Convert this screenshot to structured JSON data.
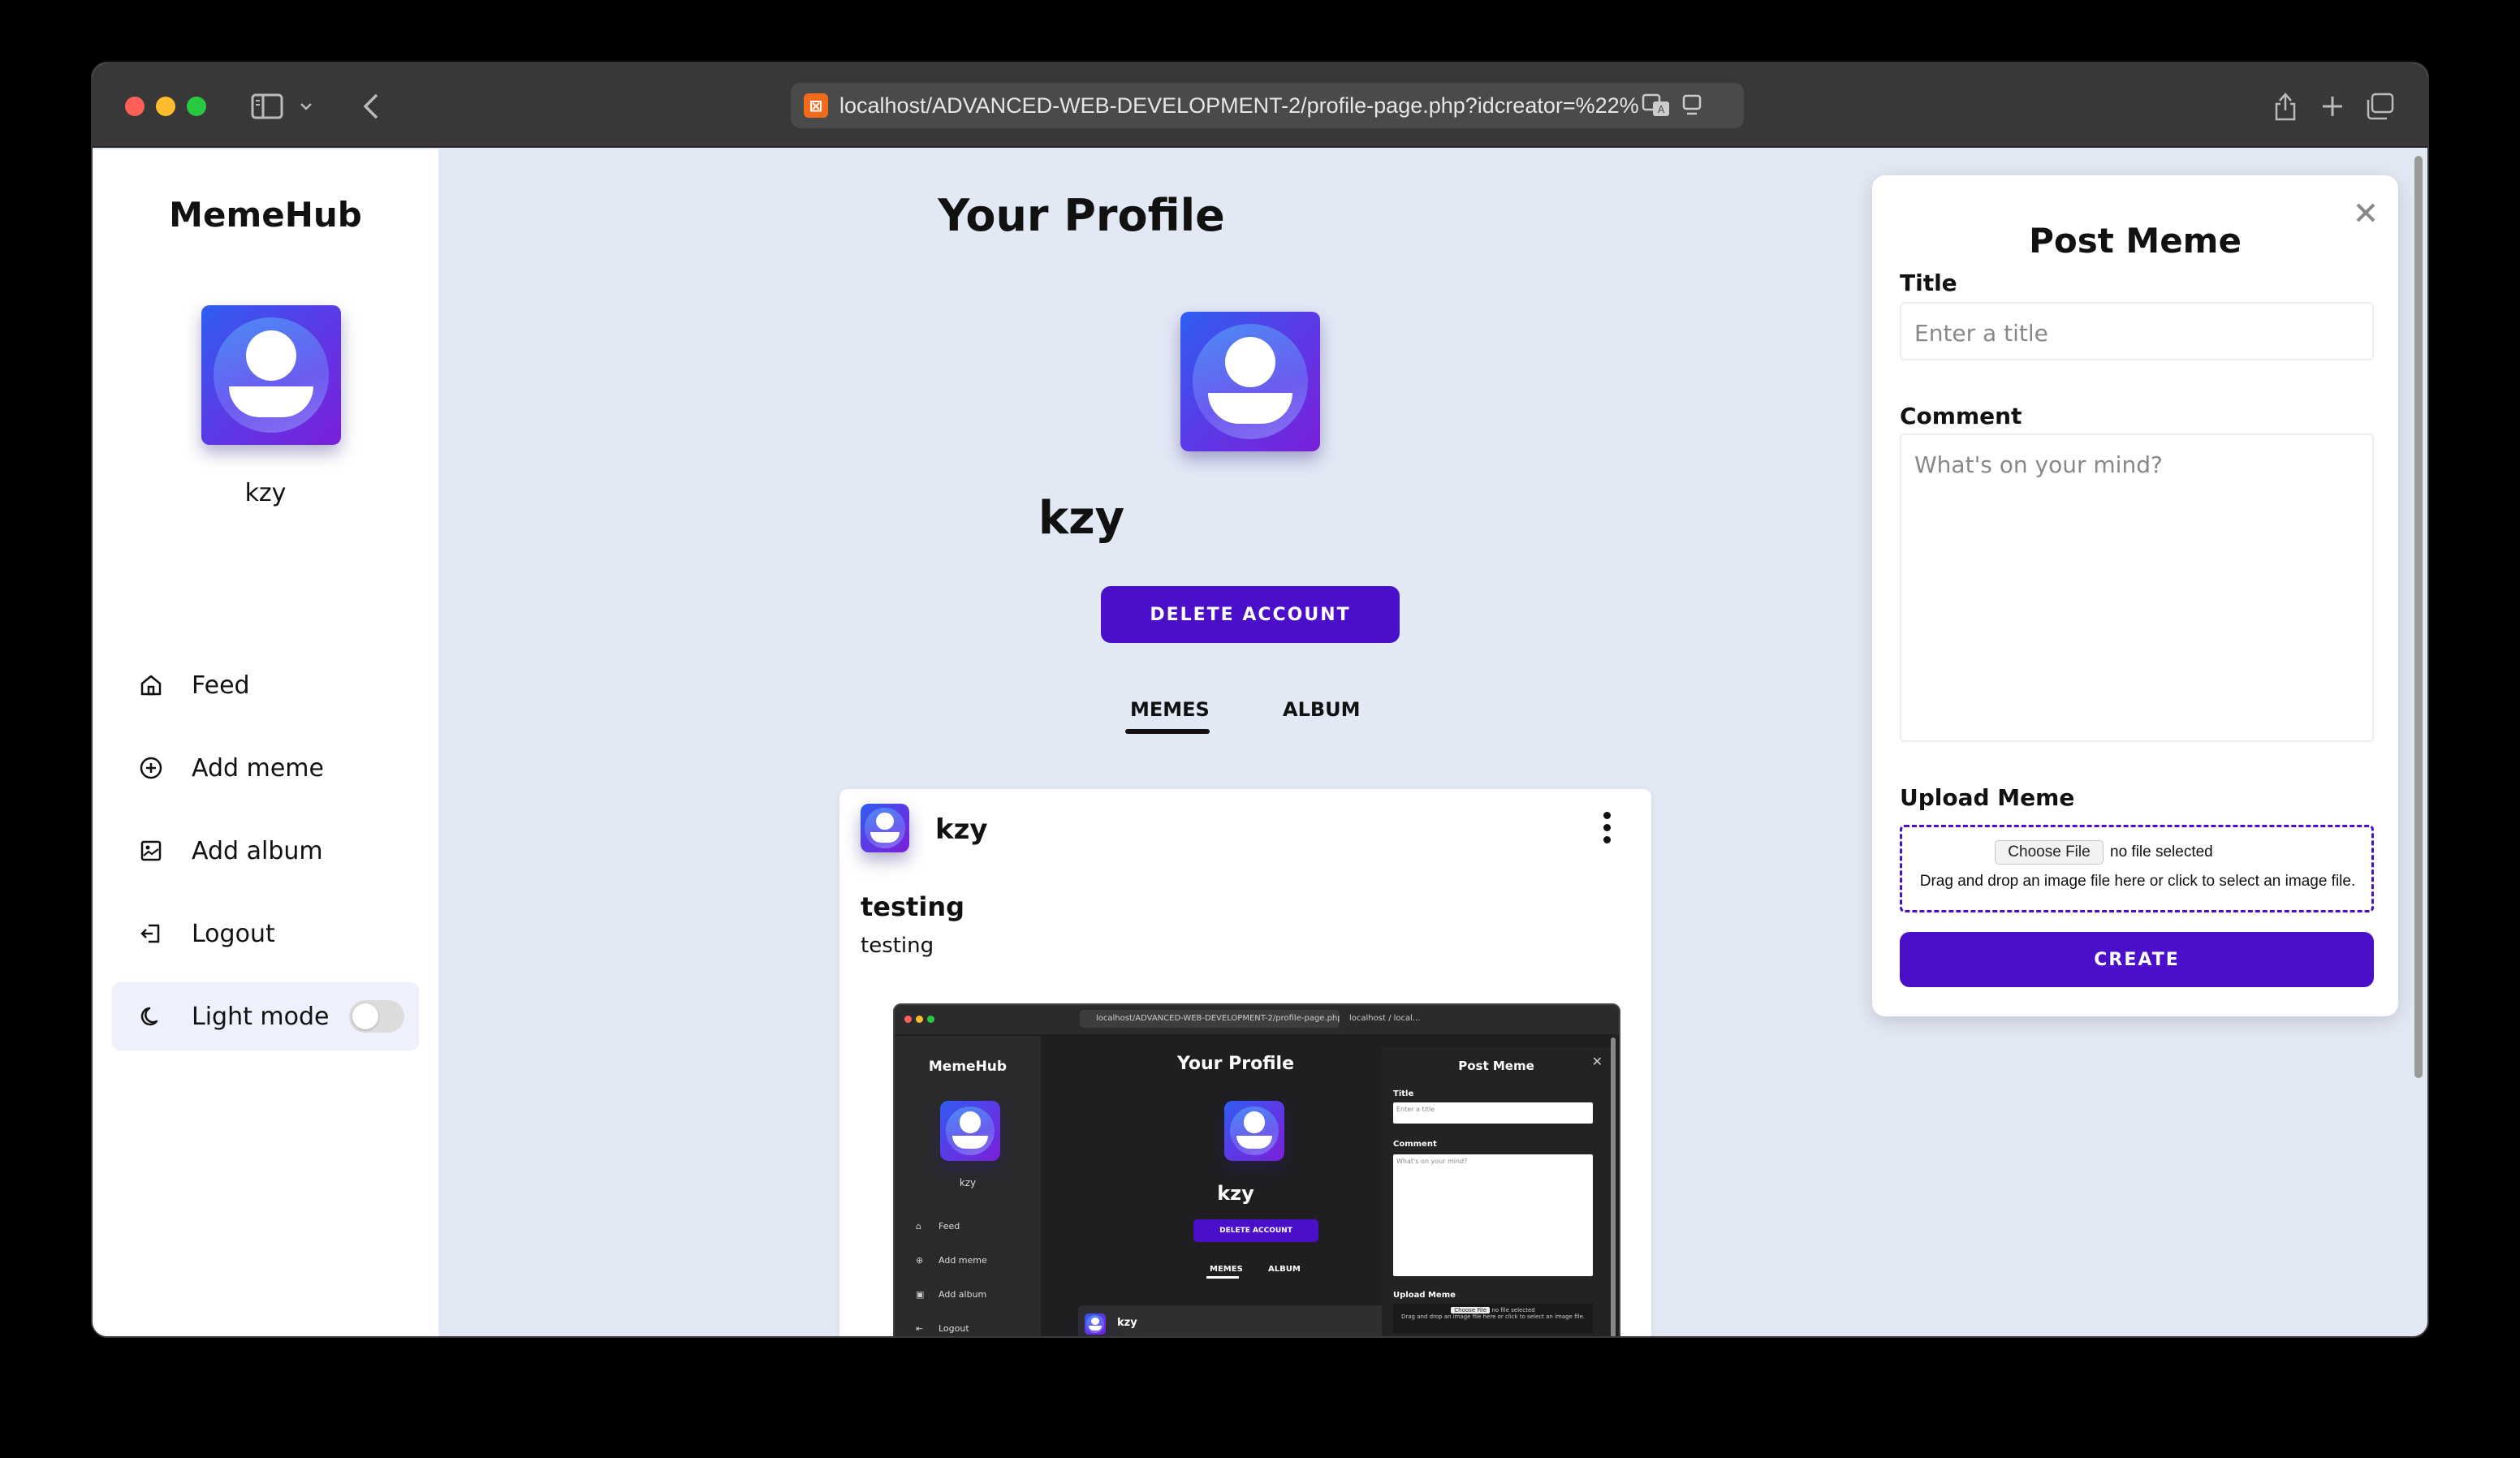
{
  "browser": {
    "url": "localhost/ADVANCED-WEB-DEVELOPMENT-2/profile-page.php?idcreator=%22%",
    "favicon_glyph": "⊠"
  },
  "sidebar": {
    "brand": "MemeHub",
    "username": "kzy",
    "items": [
      {
        "label": "Feed",
        "icon": "home-icon"
      },
      {
        "label": "Add meme",
        "icon": "plus-circle-icon"
      },
      {
        "label": "Add album",
        "icon": "image-icon"
      },
      {
        "label": "Logout",
        "icon": "logout-icon"
      },
      {
        "label": "Light mode",
        "icon": "moon-icon"
      }
    ],
    "light_mode_on": false
  },
  "main": {
    "title": "Your Profile",
    "username": "kzy",
    "delete_label": "DELETE ACCOUNT",
    "tabs": [
      {
        "label": "MEMES",
        "active": true
      },
      {
        "label": "ALBUM",
        "active": false
      }
    ],
    "post": {
      "user": "kzy",
      "title": "testing",
      "comment": "testing",
      "nested_screenshot": {
        "url": "localhost/ADVANCED-WEB-DEVELOPMENT-2/profile-page.php",
        "url2": "localhost / local...",
        "brand": "MemeHub",
        "user": "kzy",
        "nav": [
          "Feed",
          "Add meme",
          "Add album",
          "Logout"
        ],
        "title": "Your Profile",
        "main_user": "kzy",
        "delete": "DELETE ACCOUNT",
        "tab1": "MEMES",
        "tab2": "ALBUM",
        "card_user": "kzy",
        "panel_title": "Post Meme",
        "title_label": "Title",
        "title_ph": "Enter a title",
        "comment_label": "Comment",
        "comment_ph": "What's on your mind?",
        "upload_label": "Upload Meme",
        "choose": "Choose File",
        "nofile": "no file selected",
        "drop": "Drag and drop an image file here or click to select an image file."
      }
    }
  },
  "panel": {
    "title": "Post Meme",
    "title_label": "Title",
    "title_placeholder": "Enter a title",
    "comment_label": "Comment",
    "comment_placeholder": "What's on your mind?",
    "upload_label": "Upload Meme",
    "choose_file": "Choose File",
    "no_file": "no file selected",
    "drop_text": "Drag and drop an image file here or click to select an image file.",
    "create_label": "CREATE"
  },
  "colors": {
    "accent": "#4a0fc9",
    "page_bg": "#e3e8f5"
  }
}
